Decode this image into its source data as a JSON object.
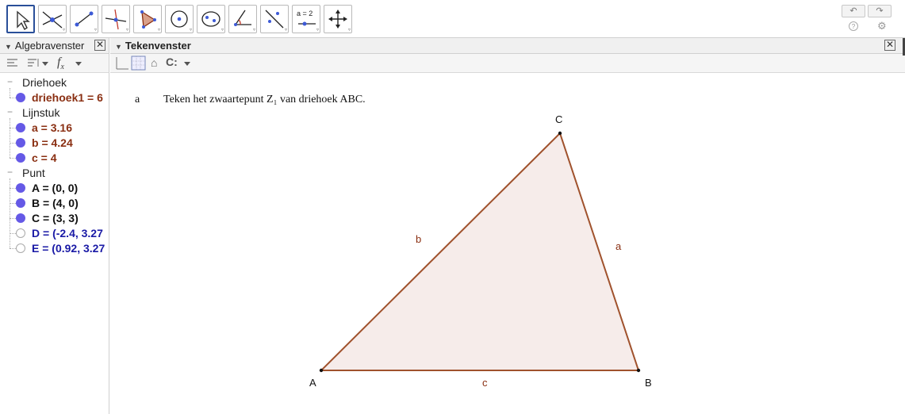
{
  "toolbar": {
    "tools": [
      {
        "name": "move-tool",
        "icon": "pointer-arrow-icon"
      },
      {
        "name": "point-tool",
        "icon": "intersect-point-icon"
      },
      {
        "name": "line-tool",
        "icon": "segment-icon"
      },
      {
        "name": "perpendicular-tool",
        "icon": "perpendicular-line-icon"
      },
      {
        "name": "polygon-tool",
        "icon": "polygon-icon"
      },
      {
        "name": "circle-tool",
        "icon": "circle-center-icon"
      },
      {
        "name": "conic-tool",
        "icon": "ellipse-icon"
      },
      {
        "name": "angle-tool",
        "icon": "angle-icon"
      },
      {
        "name": "reflect-tool",
        "icon": "reflect-line-icon"
      },
      {
        "name": "slider-tool",
        "icon": "slider-icon"
      },
      {
        "name": "move-view-tool",
        "icon": "move-graphics-icon"
      }
    ],
    "slider_label": "a = 2",
    "undo_glyph": "↶",
    "redo_glyph": "↷",
    "help_glyph": "?",
    "settings_glyph": "⚙"
  },
  "algebra": {
    "title": "Algebravenster",
    "close_glyph": "✕",
    "fx_label": "f",
    "fx_sub": "x",
    "categories": [
      {
        "label": "Driehoek",
        "items": [
          {
            "text": "driehoek1 = 6",
            "color": "#8a2f12",
            "dot": "filled"
          }
        ]
      },
      {
        "label": "Lijnstuk",
        "items": [
          {
            "text": "a = 3.16",
            "color": "#8a2f12",
            "dot": "filled"
          },
          {
            "text": "b = 4.24",
            "color": "#8a2f12",
            "dot": "filled"
          },
          {
            "text": "c = 4",
            "color": "#8a2f12",
            "dot": "filled"
          }
        ]
      },
      {
        "label": "Punt",
        "items": [
          {
            "text": "A = (0, 0)",
            "color": "#111111",
            "dot": "filled"
          },
          {
            "text": "B = (4, 0)",
            "color": "#111111",
            "dot": "filled"
          },
          {
            "text": "C = (3, 3)",
            "color": "#111111",
            "dot": "filled"
          },
          {
            "text": "D = (-2.4, 3.27",
            "color": "#1a1aa6",
            "dot": "hollow"
          },
          {
            "text": "E = (0.92, 3.27",
            "color": "#1a1aa6",
            "dot": "hollow"
          }
        ]
      }
    ]
  },
  "graphics": {
    "title": "Tekenvenster",
    "close_glyph": "✕",
    "exercise_letter": "a",
    "exercise_text": "Teken het zwaartepunt Z₁ van driehoek ABC.",
    "points": {
      "A": "A",
      "B": "B",
      "C": "C"
    },
    "segments": {
      "a": "a",
      "b": "b",
      "c": "c"
    },
    "triangle_color": "#a0522d",
    "triangle_fill": "#f6ecea"
  }
}
